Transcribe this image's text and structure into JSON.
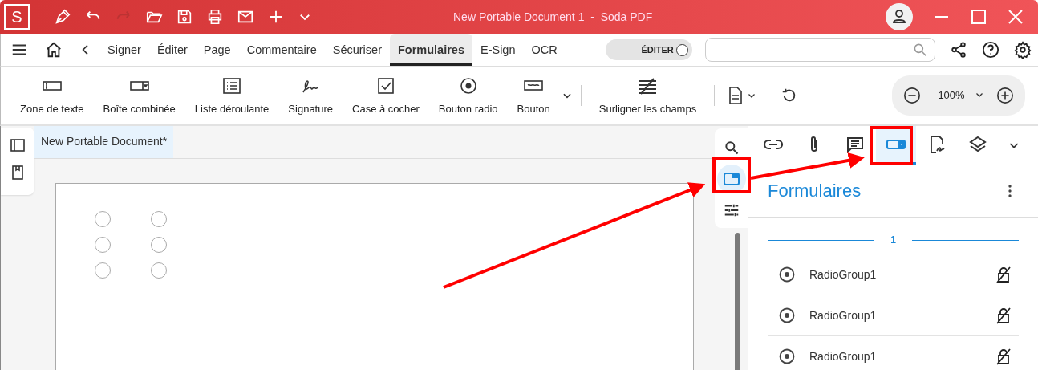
{
  "window": {
    "title": "New Portable Document 1  -  Soda PDF",
    "logo": "S"
  },
  "menu_tabs": [
    {
      "label": "Signer",
      "selected": false
    },
    {
      "label": "Éditer",
      "selected": false
    },
    {
      "label": "Page",
      "selected": false
    },
    {
      "label": "Commentaire",
      "selected": false
    },
    {
      "label": "Sécuriser",
      "selected": false
    },
    {
      "label": "Formulaires",
      "selected": true
    },
    {
      "label": "E-Sign",
      "selected": false
    },
    {
      "label": "OCR",
      "selected": false
    }
  ],
  "edit_toggle": {
    "label": "ÉDITER",
    "on": false
  },
  "toolbar": [
    {
      "kind": "textfield",
      "label": "Zone de texte"
    },
    {
      "kind": "combo",
      "label": "Boîte combinée"
    },
    {
      "kind": "list",
      "label": "Liste déroulante"
    },
    {
      "kind": "signature",
      "label": "Signature"
    },
    {
      "kind": "checkbox",
      "label": "Case à cocher"
    },
    {
      "kind": "radio",
      "label": "Bouton radio"
    },
    {
      "kind": "button",
      "label": "Bouton"
    },
    {
      "kind": "highlight",
      "label": "Surligner les champs"
    }
  ],
  "zoom": "100%",
  "document_tab": "New Portable Document*",
  "page": {
    "radio_buttons": [
      {
        "checked": false
      },
      {
        "checked": false
      },
      {
        "checked": false
      },
      {
        "checked": false
      },
      {
        "checked": false
      },
      {
        "checked": false
      }
    ]
  },
  "side_strip": [
    {
      "kind": "search",
      "selected": false
    },
    {
      "kind": "forms",
      "selected": true
    },
    {
      "kind": "settings",
      "selected": false
    }
  ],
  "panel_tabs": [
    {
      "kind": "link",
      "selected": false
    },
    {
      "kind": "attachment",
      "selected": false
    },
    {
      "kind": "comment",
      "selected": false
    },
    {
      "kind": "forms",
      "selected": true
    },
    {
      "kind": "signature",
      "selected": false
    },
    {
      "kind": "layers",
      "selected": false
    }
  ],
  "panel": {
    "title": "Formulaires",
    "page_label": "1",
    "fields": [
      {
        "kind": "radio",
        "name": "RadioGroup1"
      },
      {
        "kind": "radio",
        "name": "RadioGroup1"
      },
      {
        "kind": "radio",
        "name": "RadioGroup1"
      }
    ]
  }
}
